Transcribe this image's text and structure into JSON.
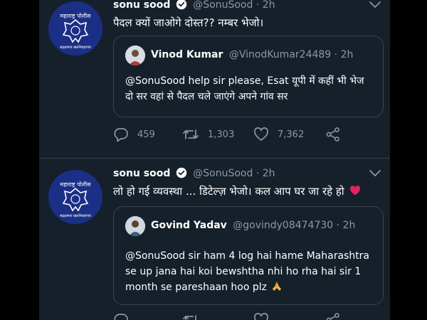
{
  "tweets": [
    {
      "author": {
        "name": "sonu sood",
        "handle": "@SonuSood",
        "time": "2h",
        "avatar_icon": "maharashtra-police-logo-icon",
        "verified_icon": "verified-badge-icon",
        "avatar_top_text": "महाराष्ट्र पोलीस",
        "avatar_bottom_text": "सद्रक्षणाय खलनिग्रहणाय"
      },
      "text": "पैदल क्यों जाओगे दोस्त?? नम्बर भेजो।",
      "quoted": {
        "name": "Vinod Kumar",
        "handle": "@VinodKumar24489",
        "time": "2h",
        "text": "@SonuSood help sir please, Esat यूपी में कहीं भी भेज दो सर वहां से पैदल चले जाएंगे अपने गांव सर"
      },
      "actions": {
        "replies": "459",
        "retweets": "1,303",
        "likes": "7,362"
      }
    },
    {
      "author": {
        "name": "sonu sood",
        "handle": "@SonuSood",
        "time": "2h",
        "avatar_icon": "maharashtra-police-logo-icon",
        "verified_icon": "verified-badge-icon",
        "avatar_top_text": "महाराष्ट्र पोलीस",
        "avatar_bottom_text": "सद्रक्षणाय खलनिग्रहणाय"
      },
      "text": "लो हो गई व्यवस्था ... डिटेल्ज़ भेजो। कल आप घर जा रहे हो",
      "emoji": "heart-emoji-icon",
      "quoted": {
        "name": "Govind Yadav",
        "handle": "@govindy08474730",
        "time": "2h",
        "text": "@SonuSood sir ham 4 log hai hame Maharashtra se up jana hai koi bewshtha nhi ho rha hai sir 1 month se pareshaan hoo plz",
        "emoji": "folded-hands-emoji-icon"
      }
    }
  ],
  "sep": "·",
  "colors": {
    "background": "#15202b",
    "text": "#ffffff",
    "muted": "#8b98a5",
    "border": "#38444d",
    "verified": "#ffffff",
    "heart": "#e0245e"
  }
}
